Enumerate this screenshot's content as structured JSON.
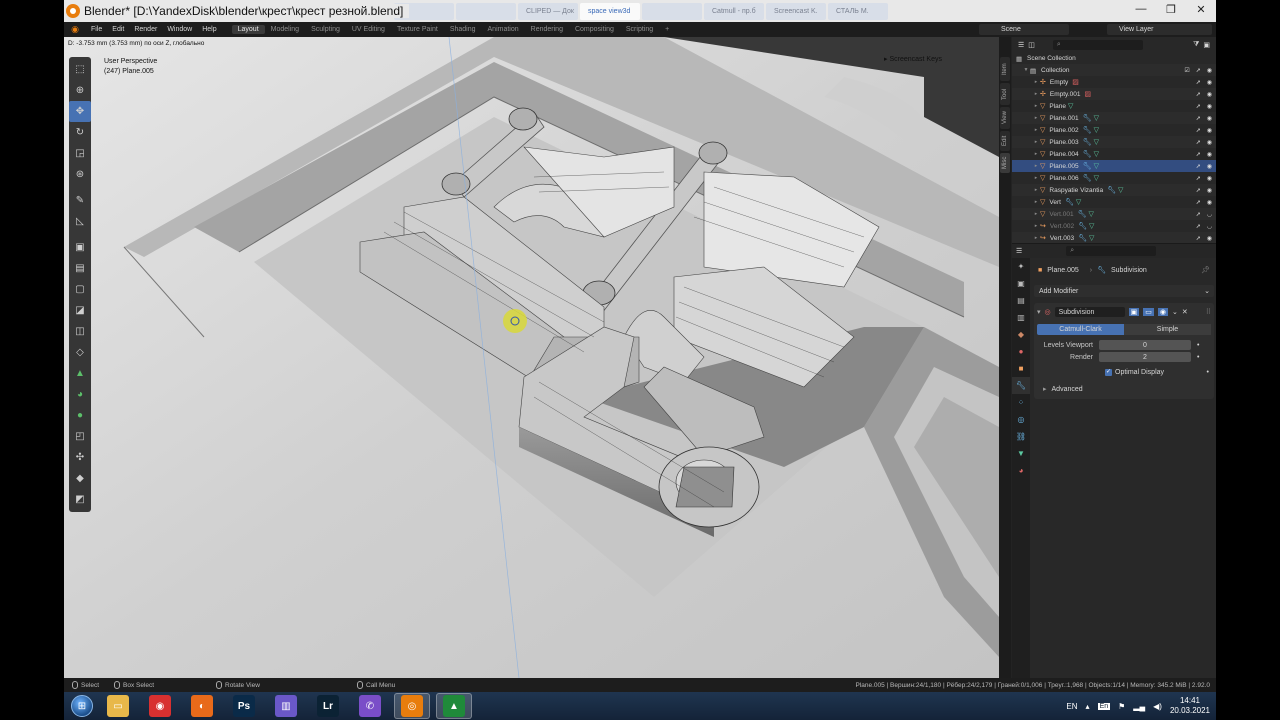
{
  "window": {
    "title": "Blender* [D:\\YandexDisk\\blender\\крест\\крест резной.blend]",
    "background_tabs": [
      "",
      "",
      "CLIPED — Док",
      "space view3d",
      "",
      "Catmull - пр.б",
      "Screencast K.",
      "СТАЛЬ М."
    ],
    "controls": [
      "—",
      "❐",
      "✕"
    ]
  },
  "menu": [
    "File",
    "Edit",
    "Render",
    "Window",
    "Help"
  ],
  "workspaces": [
    "Layout",
    "Modeling",
    "Sculpting",
    "UV Editing",
    "Texture Paint",
    "Shading",
    "Animation",
    "Rendering",
    "Compositing",
    "Scripting",
    "+"
  ],
  "scene": {
    "label": "Scene",
    "view_layer": "View Layer"
  },
  "viewport": {
    "header_text": "D: -3.753 mm (3.753 mm) по оси Z, глобально",
    "perspective": "User Perspective",
    "object_info": "(247) Plane.005",
    "screencast": "Screencast Keys",
    "side_tabs": [
      "Item",
      "Tool",
      "View",
      "Edit",
      "Misc"
    ]
  },
  "tools": [
    {
      "icon": "select-box-icon",
      "glyph": "⬚"
    },
    {
      "icon": "cursor-icon",
      "glyph": "⊕"
    },
    {
      "icon": "move-icon",
      "glyph": "✥"
    },
    {
      "icon": "rotate-icon",
      "glyph": "↻"
    },
    {
      "icon": "scale-icon",
      "glyph": "◲"
    },
    {
      "icon": "transform-icon",
      "glyph": "⊛"
    },
    {
      "icon": "annotate-icon",
      "glyph": "✎"
    },
    {
      "icon": "measure-icon",
      "glyph": "◺"
    },
    {
      "icon": "add-cube-icon",
      "glyph": "▣"
    },
    {
      "icon": "extrude-icon",
      "glyph": "▤"
    },
    {
      "icon": "inset-icon",
      "glyph": "▢"
    },
    {
      "icon": "bevel-icon",
      "glyph": "◪"
    },
    {
      "icon": "loop-cut-icon",
      "glyph": "◫"
    },
    {
      "icon": "knife-icon",
      "glyph": "◇"
    },
    {
      "icon": "poly-build-icon",
      "glyph": "▲"
    },
    {
      "icon": "spin-icon",
      "glyph": "◕"
    },
    {
      "icon": "smooth-icon",
      "glyph": "●"
    },
    {
      "icon": "edge-slide-icon",
      "glyph": "◰"
    },
    {
      "icon": "shrink-fatten-icon",
      "glyph": "✣"
    },
    {
      "icon": "shear-icon",
      "glyph": "◆"
    },
    {
      "icon": "rip-region-icon",
      "glyph": "◩"
    }
  ],
  "outliner": {
    "root": "Scene Collection",
    "collection": "Collection",
    "items": [
      {
        "name": "Empty",
        "type": "empty"
      },
      {
        "name": "Empty.001",
        "type": "empty"
      },
      {
        "name": "Plane",
        "type": "mesh"
      },
      {
        "name": "Plane.001",
        "type": "mesh"
      },
      {
        "name": "Plane.002",
        "type": "mesh"
      },
      {
        "name": "Plane.003",
        "type": "mesh"
      },
      {
        "name": "Plane.004",
        "type": "mesh"
      },
      {
        "name": "Plane.005",
        "type": "mesh",
        "selected": true
      },
      {
        "name": "Plane.006",
        "type": "mesh"
      },
      {
        "name": "Raspyatie Vizantia",
        "type": "mesh"
      },
      {
        "name": "Vert",
        "type": "mesh"
      },
      {
        "name": "Vert.001",
        "type": "mesh",
        "dim": true
      },
      {
        "name": "Vert.002",
        "type": "curve",
        "dim": true
      },
      {
        "name": "Vert.003",
        "type": "curve"
      }
    ]
  },
  "properties": {
    "object": "Plane.005",
    "modifier_tab": "Subdivision",
    "add_modifier": "Add Modifier",
    "modifier": {
      "name": "Subdivision",
      "mode_a": "Catmull-Clark",
      "mode_b": "Simple",
      "levels_label": "Levels Viewport",
      "levels_value": "0",
      "render_label": "Render",
      "render_value": "2",
      "optimal": "Optimal Display",
      "advanced": "Advanced"
    }
  },
  "status": {
    "select": "Select",
    "box_select": "Box Select",
    "rotate": "Rotate View",
    "call_menu": "Call Menu",
    "stats": "Plane.005 | Вершин:24/1,180 | Рёбер:24/2,179 | Граней:0/1,006 | Треуг.:1,968 | Objects:1/14 | Memory: 345.2 MiB | 2.92.0"
  },
  "taskbar": {
    "apps": [
      {
        "name": "explorer",
        "glyph": "▭",
        "color": "#e8b84a"
      },
      {
        "name": "screenshot-tool",
        "glyph": "◉",
        "color": "#d83030"
      },
      {
        "name": "firefox",
        "glyph": "◐",
        "color": "#e86a1a"
      },
      {
        "name": "photoshop",
        "glyph": "Ps",
        "color": "#0a2a48"
      },
      {
        "name": "save-tool",
        "glyph": "▥",
        "color": "#6a58c8"
      },
      {
        "name": "lightroom",
        "glyph": "Lr",
        "color": "#0b2234"
      },
      {
        "name": "viber",
        "glyph": "✆",
        "color": "#7a4ec8"
      },
      {
        "name": "blender",
        "glyph": "◎",
        "color": "#e87d0d"
      },
      {
        "name": "obs-like",
        "glyph": "▲",
        "color": "#1f8a3a"
      }
    ],
    "lang": "EN",
    "kbd": "En",
    "time": "14:41",
    "date": "20.03.2021"
  }
}
